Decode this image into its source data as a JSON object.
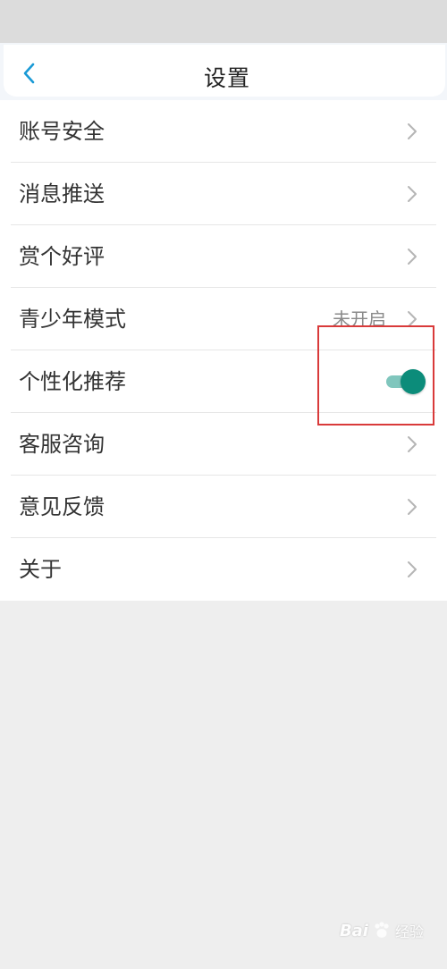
{
  "header": {
    "title": "设置",
    "back_icon": "chevron-left-icon",
    "back_color": "#1a9ad6"
  },
  "settings": {
    "items": [
      {
        "label": "账号安全"
      },
      {
        "label": "消息推送"
      },
      {
        "label": "赏个好评"
      },
      {
        "label": "青少年模式",
        "value": "未开启"
      },
      {
        "label": "个性化推荐",
        "toggle_on": true
      },
      {
        "label": "客服咨询"
      },
      {
        "label": "意见反馈"
      },
      {
        "label": "关于"
      }
    ]
  },
  "colors": {
    "toggle_thumb": "#0c8c7a",
    "toggle_track": "#80c6bd",
    "highlight_box": "#d93a3a",
    "background": "#eeeeee"
  },
  "watermark": {
    "logo": "Bai",
    "text": "经验"
  }
}
